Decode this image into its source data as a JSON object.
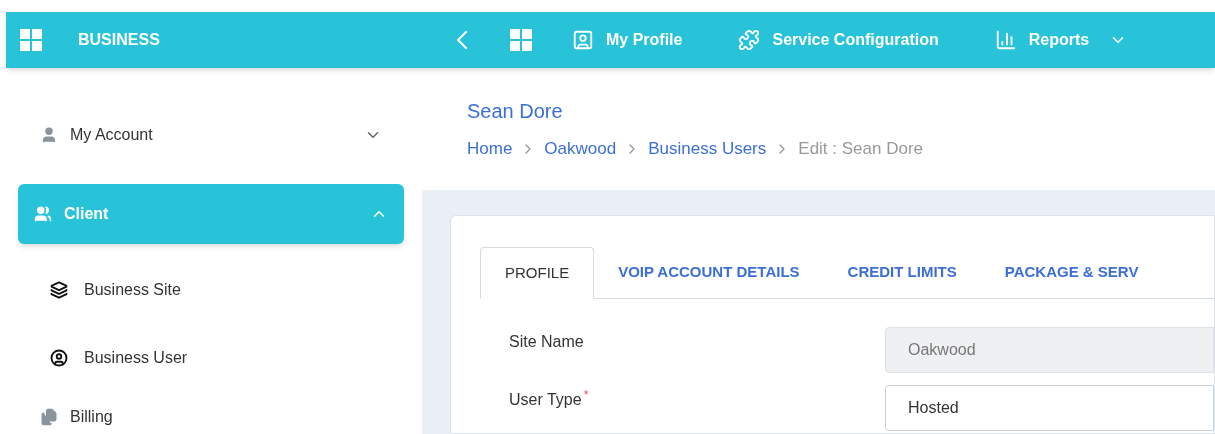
{
  "header": {
    "brand": "BUSINESS",
    "nav": [
      {
        "kind": "back"
      },
      {
        "kind": "grid"
      },
      {
        "kind": "profile",
        "label": "My Profile"
      },
      {
        "kind": "service",
        "label": "Service Configuration"
      },
      {
        "kind": "reports",
        "label": "Reports",
        "dropdown": true
      }
    ]
  },
  "sidebar": {
    "items": [
      {
        "label": "My Account",
        "expanded": false,
        "selected": false
      },
      {
        "label": "Client",
        "expanded": true,
        "selected": true,
        "children": [
          {
            "label": "Business Site"
          },
          {
            "label": "Business User"
          }
        ]
      },
      {
        "label": "Billing"
      }
    ]
  },
  "page": {
    "title": "Sean Dore",
    "breadcrumb": [
      {
        "label": "Home",
        "link": true
      },
      {
        "label": "Oakwood",
        "link": true
      },
      {
        "label": "Business Users",
        "link": true
      },
      {
        "label": "Edit : Sean Dore",
        "link": false
      }
    ]
  },
  "tabs": [
    {
      "label": "PROFILE",
      "selected": true
    },
    {
      "label": "VOIP ACCOUNT DETAILS",
      "selected": false
    },
    {
      "label": "CREDIT LIMITS",
      "selected": false
    },
    {
      "label": "PACKAGE & SERV",
      "selected": false
    }
  ],
  "form": [
    {
      "label": "Site Name",
      "value": "Oakwood",
      "disabled": true
    },
    {
      "label": "User Type",
      "required_mark": "*",
      "value": "Hosted",
      "disabled": false
    }
  ]
}
